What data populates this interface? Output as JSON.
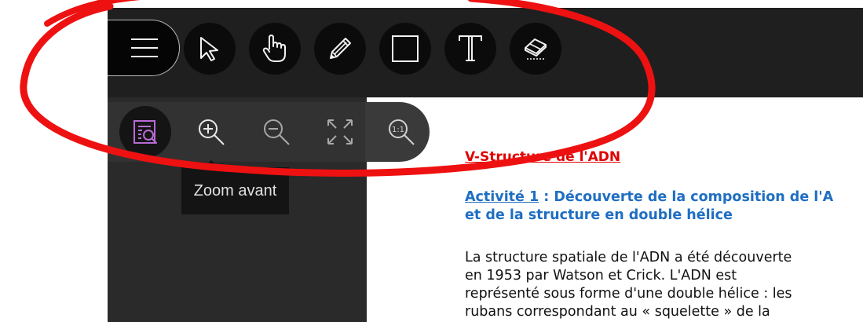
{
  "toolbar": {
    "menu_icon": "hamburger-icon",
    "tools": [
      {
        "name": "pointer",
        "icon": "arrow-cursor-icon"
      },
      {
        "name": "pan",
        "icon": "hand-icon"
      },
      {
        "name": "pencil",
        "icon": "pencil-icon"
      },
      {
        "name": "rectangle",
        "icon": "square-icon"
      },
      {
        "name": "text",
        "icon": "text-icon"
      },
      {
        "name": "eraser",
        "icon": "eraser-icon"
      }
    ]
  },
  "zoom_bar": {
    "buttons": [
      {
        "name": "zoom-menu",
        "icon": "zoom-page-icon",
        "active": true
      },
      {
        "name": "zoom-in",
        "icon": "zoom-in-icon"
      },
      {
        "name": "zoom-out",
        "icon": "zoom-out-icon"
      },
      {
        "name": "fit",
        "icon": "fullscreen-icon"
      },
      {
        "name": "actual-size",
        "icon": "zoom-1-1-icon",
        "label": "1:1"
      }
    ],
    "tooltip": "Zoom avant"
  },
  "document": {
    "title": "V-Structure de l'ADN",
    "activity_link": "Activité 1",
    "activity_rest": " : Découverte de la composition de l'A",
    "activity_line2": "et de la structure en double hélice",
    "paragraph_lines": [
      "La structure spatiale de l'ADN a été découverte",
      "en 1953 par Watson et Crick. L'ADN est",
      "représenté sous forme d'une double hélice : les",
      "rubans correspondant au « squelette » de la"
    ]
  },
  "colors": {
    "toolbar_bg": "#1f1f1f",
    "panel_bg": "#2a2a2a",
    "active_purple": "#b86bd6",
    "title_red": "#e00000",
    "activity_blue": "#1f6ec2",
    "annotation_red": "#ee1111"
  }
}
